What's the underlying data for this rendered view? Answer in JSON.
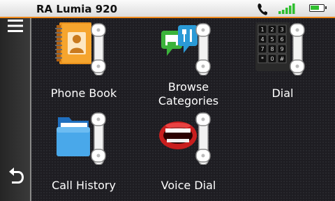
{
  "status_bar": {
    "device_name": "RA Lumia 920",
    "icons": [
      "phone-handset-icon",
      "signal-bars-icon",
      "battery-icon"
    ],
    "accent_color": "#f08a1c",
    "signal_color": "#2fbf2f",
    "battery_color": "#2fbf2f",
    "battery_level": 0.7
  },
  "sidebar": {
    "menu_icon": "hamburger-menu-icon",
    "back_icon": "back-arrow-icon"
  },
  "menu": {
    "items": [
      {
        "label": "Phone Book",
        "icon": "phone-book-icon"
      },
      {
        "label": "Browse\nCategories",
        "icon": "browse-categories-icon"
      },
      {
        "label": "Dial",
        "icon": "dial-keypad-icon"
      },
      {
        "label": "Call History",
        "icon": "call-history-icon"
      },
      {
        "label": "Voice Dial",
        "icon": "voice-dial-icon"
      }
    ]
  }
}
